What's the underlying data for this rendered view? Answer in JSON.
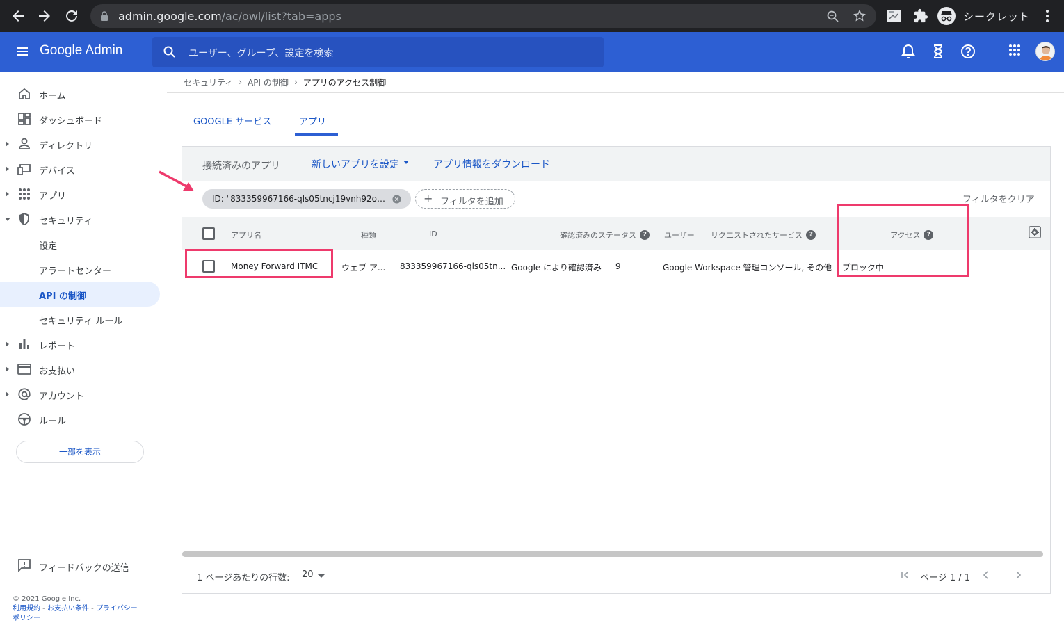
{
  "browser": {
    "url_host": "admin.google.com",
    "url_path": "/ac/owl/list?tab=apps",
    "profile_label": "シークレット"
  },
  "appbar": {
    "brand": "Google Admin",
    "search_placeholder": "ユーザー、グループ、設定を検索"
  },
  "sidebar": {
    "items": [
      {
        "label": "ホーム"
      },
      {
        "label": "ダッシュボード"
      },
      {
        "label": "ディレクトリ"
      },
      {
        "label": "デバイス"
      },
      {
        "label": "アプリ"
      },
      {
        "label": "セキュリティ"
      },
      {
        "label": "設定"
      },
      {
        "label": "アラートセンター"
      },
      {
        "label": "API の制御"
      },
      {
        "label": "セキュリティ ルール"
      },
      {
        "label": "レポート"
      },
      {
        "label": "お支払い"
      },
      {
        "label": "アカウント"
      },
      {
        "label": "ルール"
      }
    ],
    "show_more": "一部を表示",
    "feedback": "フィードバックの送信",
    "copyright": "© 2021 Google Inc.",
    "terms": "利用規約",
    "billing_terms": "お支払い条件",
    "privacy_a": "プライバシー",
    "privacy_b": "ポリシー"
  },
  "breadcrumb": {
    "items": [
      "セキュリティ",
      "API の制御",
      "アプリのアクセス制御"
    ]
  },
  "tabs": [
    {
      "label": "GOOGLE サービス",
      "active": false
    },
    {
      "label": "アプリ",
      "active": true
    }
  ],
  "toolbar": {
    "title": "接続済みのアプリ",
    "configure_new": "新しいアプリを設定",
    "download": "アプリ情報をダウンロード"
  },
  "filters": {
    "chip": "ID: \"833359967166-qls05tncj19vnh92ovkj7...",
    "add_filter": "フィルタを追加",
    "clear": "フィルタをクリア"
  },
  "table": {
    "headers": {
      "app_name": "アプリ名",
      "type": "種類",
      "id": "ID",
      "verified_status": "確認済みのステータス",
      "users": "ユーザー",
      "requested_services": "リクエストされたサービス",
      "access": "アクセス"
    },
    "rows": [
      {
        "app_name": "Money Forward ITMC",
        "type": "ウェブ ア...",
        "id": "833359967166-qls05tn...",
        "verified_status": "Google により確認済み",
        "users": "9",
        "requested_services": "Google Workspace 管理コンソール, その他",
        "access": "ブロック中"
      }
    ]
  },
  "footer": {
    "rows_per_page_label": "1 ページあたりの行数:",
    "rows_per_page_value": "20",
    "page_label": "ページ 1 / 1"
  },
  "colors": {
    "appbar": "#2d5fd3",
    "link": "#1a56c6",
    "highlight": "#ee3a6c"
  }
}
